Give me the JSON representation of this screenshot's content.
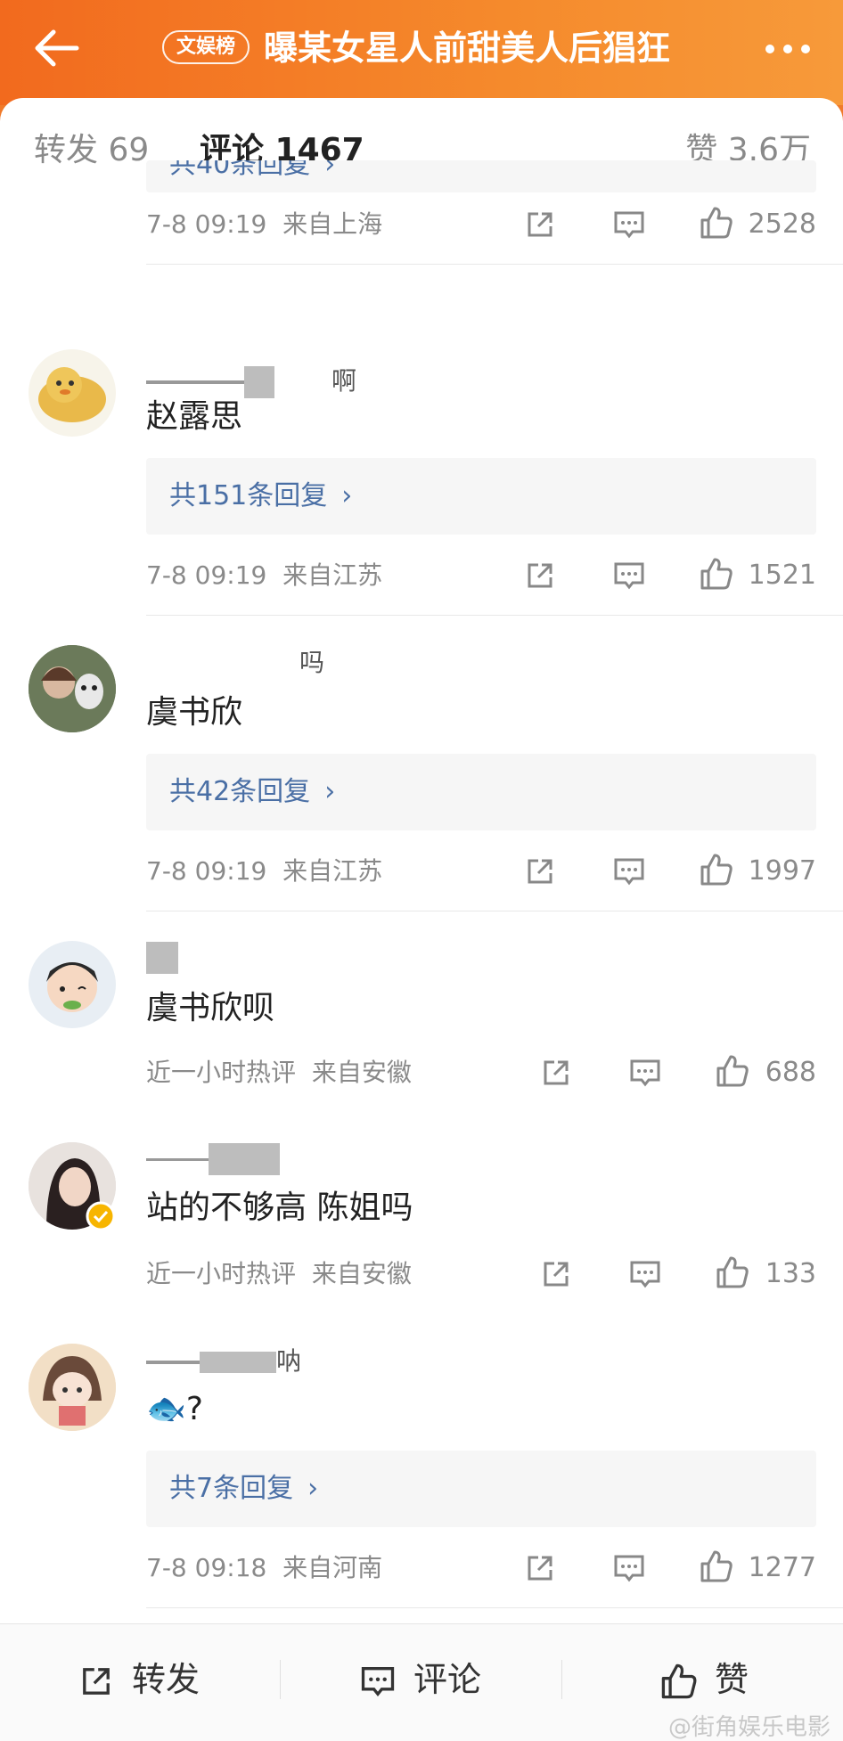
{
  "header": {
    "tag": "文娱榜",
    "title": "曝某女星人前甜美人后猖狂"
  },
  "tabs": {
    "reposts": "转发 69",
    "comments": "评论 1467",
    "likes": "赞 3.6万"
  },
  "comments": [
    {
      "reply_label": "共40条回复",
      "time": "7-8 09:19",
      "location": "来自上海",
      "likes": "2528"
    },
    {
      "username_suffix": "啊",
      "text": "赵露思",
      "reply_label": "共151条回复",
      "time": "7-8 09:19",
      "location": "来自江苏",
      "likes": "1521"
    },
    {
      "username_suffix": "吗",
      "text": "虞书欣",
      "reply_label": "共42条回复",
      "time": "7-8 09:19",
      "location": "来自江苏",
      "likes": "1997"
    },
    {
      "text": "虞书欣呗",
      "time": "近一小时热评",
      "location": "来自安徽",
      "likes": "688"
    },
    {
      "text": "站的不够高 陈姐吗",
      "time": "近一小时热评",
      "location": "来自安徽",
      "likes": "133"
    },
    {
      "username_suffix": "呐",
      "text": "🐟?",
      "reply_label": "共7条回复",
      "time": "7-8 09:18",
      "location": "来自河南",
      "likes": "1277"
    }
  ],
  "bottom_bar": {
    "repost": "转发",
    "comment": "评论",
    "like": "赞"
  },
  "watermark": "@街角娱乐电影",
  "colors": {
    "header_orange": "#f26a1e",
    "reply_link_blue": "#4a6fa5",
    "tab_underline": "#f78a2a"
  }
}
